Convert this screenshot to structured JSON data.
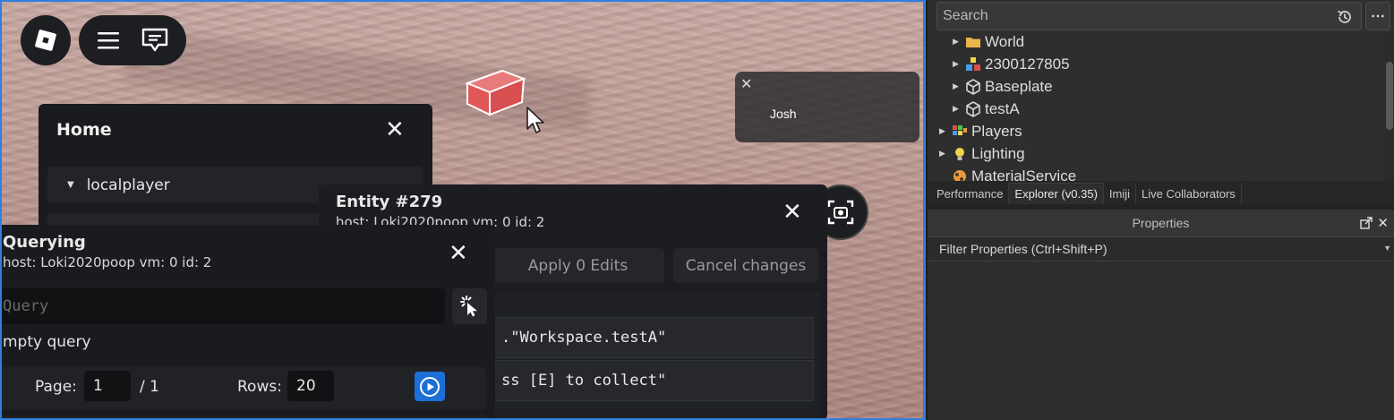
{
  "game": {
    "player_card": {
      "name": "Josh"
    }
  },
  "home": {
    "title": "Home",
    "rows": [
      "localplayer"
    ]
  },
  "entity": {
    "title": "Entity #279",
    "subtitle": "host: Loki2020poop vm: 0 id: 2",
    "apply_label": "Apply 0 Edits",
    "cancel_label": "Cancel changes",
    "code_rows": [
      ".\"Workspace.testA\"",
      "ss [E] to collect\""
    ]
  },
  "query": {
    "title": "Querying",
    "subtitle": "host: Loki2020poop vm: 0 id: 2",
    "placeholder": "Query",
    "status": "mpty query",
    "page_label": "Page:",
    "page_value": "1",
    "page_total": "/ 1",
    "rows_label": "Rows:",
    "rows_value": "20"
  },
  "studio": {
    "search_placeholder": "Search",
    "tree": [
      {
        "label": "World",
        "icon": "folder-icon",
        "color": "#e8b64a"
      },
      {
        "label": "2300127805",
        "icon": "model-icon",
        "color": "#4a9ae8"
      },
      {
        "label": "Baseplate",
        "icon": "part-icon",
        "color": "#d6d6d6"
      },
      {
        "label": "testA",
        "icon": "part-icon",
        "color": "#d6d6d6"
      },
      {
        "label": "Players",
        "icon": "players-icon",
        "color": "#d94f4f"
      },
      {
        "label": "Lighting",
        "icon": "lightbulb-icon",
        "color": "#f2d44a"
      },
      {
        "label": "MaterialService",
        "icon": "material-icon",
        "color": "#e89a3a"
      }
    ],
    "tabs": [
      "Performance",
      "Explorer (v0.35)",
      "Imiji",
      "Live Collaborators"
    ],
    "active_tab": "Explorer (v0.35)",
    "properties_title": "Properties",
    "filter_placeholder": "Filter Properties (Ctrl+Shift+P)"
  },
  "colors": {
    "accent": "#1d6fd8",
    "panel_bg": "#191b1e",
    "studio_bg": "#2e2e2e",
    "cube": "#e05858"
  }
}
